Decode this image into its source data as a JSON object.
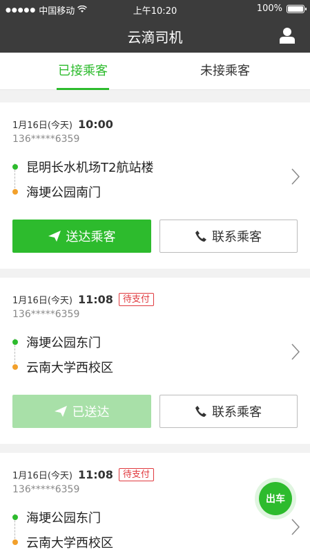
{
  "status_bar": {
    "signal": "●●●●●",
    "carrier": "中国移动",
    "time": "上午10:20",
    "battery": "100%"
  },
  "header": {
    "title": "云滴司机"
  },
  "tabs": [
    {
      "label": "已接乘客"
    },
    {
      "label": "未接乘客"
    }
  ],
  "orders": [
    {
      "date": "1月16日(今天)",
      "time": "10:00",
      "badge": "",
      "phone": "136*****6359",
      "from": "昆明长水机场T2航站楼",
      "to": "海埂公园南门",
      "primary_button": "送达乘客",
      "contact_button": "联系乘客"
    },
    {
      "date": "1月16日(今天)",
      "time": "11:08",
      "badge": "待支付",
      "phone": "136*****6359",
      "from": "海埂公园东门",
      "to": "云南大学西校区",
      "primary_button": "已送达",
      "contact_button": "联系乘客"
    },
    {
      "date": "1月16日(今天)",
      "time": "11:08",
      "badge": "待支付",
      "phone": "136*****6359",
      "from": "海埂公园东门",
      "to": "云南大学西校区"
    }
  ],
  "fab": {
    "label": "出车"
  },
  "colors": {
    "accent": "#2dbb2d",
    "header_bg": "#3c3c3c",
    "badge_red": "#e0393e",
    "start_dot": "#2dbb2d",
    "end_dot": "#f2a02b"
  }
}
